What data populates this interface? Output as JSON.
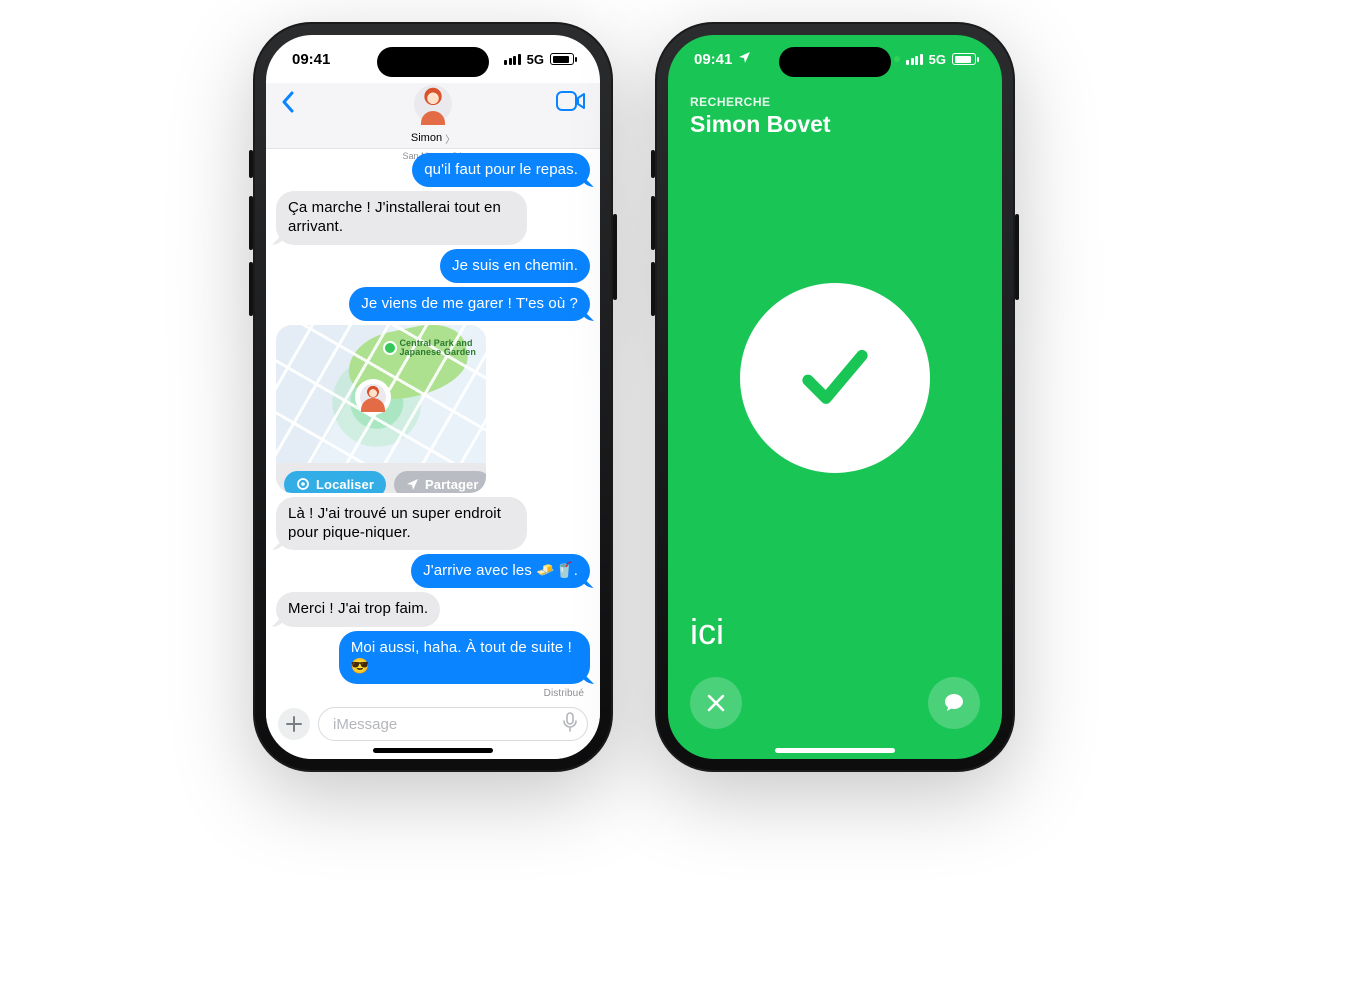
{
  "status": {
    "time": "09:41",
    "network": "5G"
  },
  "messages": {
    "contact_name": "Simon",
    "contact_location": "San Mateo, CA",
    "input_placeholder": "iMessage",
    "delivered_label": "Distribué",
    "map": {
      "poi_label": "Central Park and\nJapanese Garden",
      "actions": {
        "find": "Localiser",
        "share": "Partager"
      }
    },
    "thread": [
      {
        "side": "sent",
        "text": "qu'il faut pour le repas.",
        "tail": true
      },
      {
        "side": "recv",
        "text": "Ça marche ! J'installerai tout en arrivant.",
        "tail": true
      },
      {
        "side": "sent",
        "text": "Je suis en chemin.",
        "tail": false
      },
      {
        "side": "sent",
        "text": "Je viens de me garer ! T'es où ?",
        "tail": true
      },
      {
        "side": "recv",
        "text": "Là ! J'ai trouvé un super endroit pour pique-niquer.",
        "tail": true
      },
      {
        "side": "sent",
        "text": "J'arrive avec les 🧈🥤.",
        "tail": true
      },
      {
        "side": "recv",
        "text": "Merci ! J'ai trop faim.",
        "tail": true
      },
      {
        "side": "sent",
        "text": "Moi aussi, haha. À tout de suite ! 😎",
        "tail": true
      }
    ]
  },
  "findmy": {
    "search_label": "RECHERCHE",
    "person_name": "Simon Bovet",
    "here_label": "ici"
  }
}
